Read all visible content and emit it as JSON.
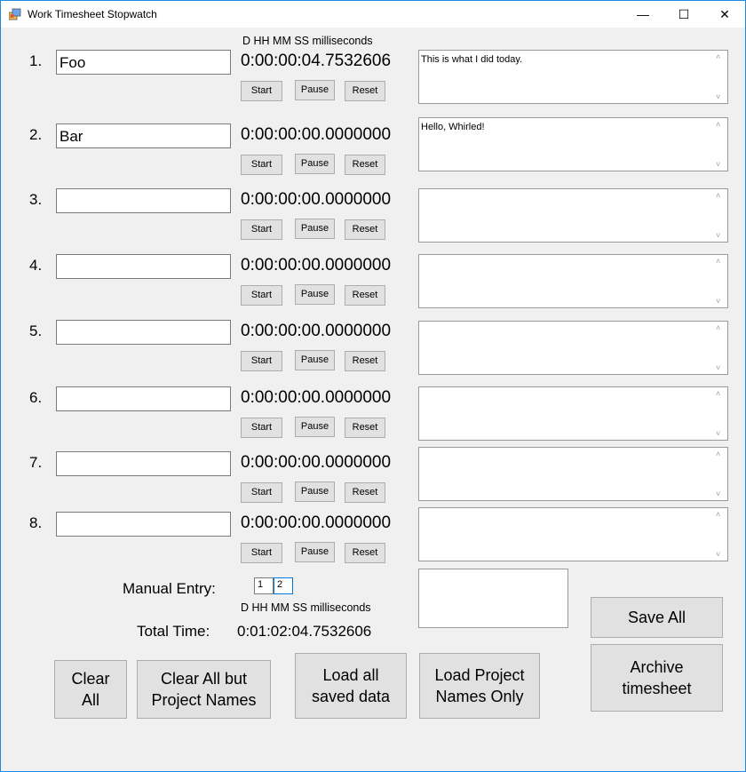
{
  "window": {
    "title": "Work Timesheet Stopwatch",
    "minimize": "—",
    "maximize": "☐",
    "close": "✕"
  },
  "header_format": "D HH MM SS milliseconds",
  "buttons": {
    "start": "Start",
    "pause": "Pause",
    "reset": "Reset"
  },
  "rows": [
    {
      "num": "1.",
      "project": "Foo",
      "time": "0:00:00:04.7532606",
      "notes": "This is what I did today."
    },
    {
      "num": "2.",
      "project": "Bar",
      "time": "0:00:00:00.0000000",
      "notes": "Hello, Whirled!"
    },
    {
      "num": "3.",
      "project": "",
      "time": "0:00:00:00.0000000",
      "notes": ""
    },
    {
      "num": "4.",
      "project": "",
      "time": "0:00:00:00.0000000",
      "notes": ""
    },
    {
      "num": "5.",
      "project": "",
      "time": "0:00:00:00.0000000",
      "notes": ""
    },
    {
      "num": "6.",
      "project": "",
      "time": "0:00:00:00.0000000",
      "notes": ""
    },
    {
      "num": "7.",
      "project": "",
      "time": "0:00:00:00.0000000",
      "notes": ""
    },
    {
      "num": "8.",
      "project": "",
      "time": "0:00:00:00.0000000",
      "notes": ""
    }
  ],
  "manual": {
    "label": "Manual Entry:",
    "field1": "1",
    "field2": "2",
    "format": "D HH MM SS milliseconds"
  },
  "total": {
    "label": "Total Time:",
    "value": "0:01:02:04.7532606"
  },
  "actions": {
    "clear_all": "Clear\nAll",
    "clear_but_names": "Clear All but\nProject Names",
    "load_all": "Load all\nsaved data",
    "load_names": "Load Project\nNames Only",
    "save_all": "Save All",
    "archive": "Archive\ntimesheet"
  }
}
